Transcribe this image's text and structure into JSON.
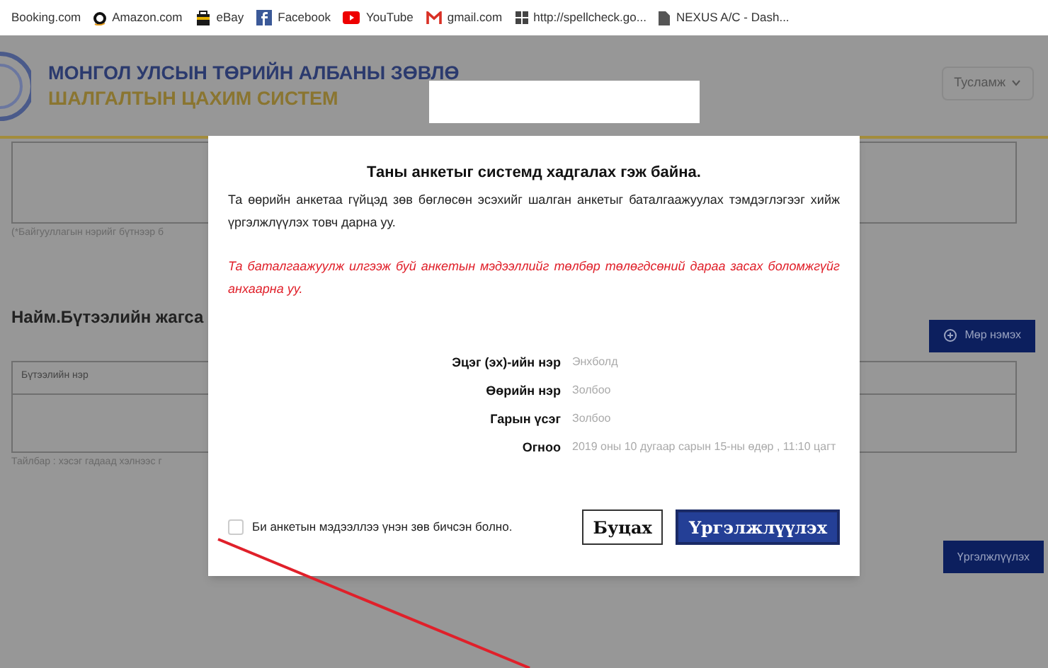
{
  "bookmarks": [
    {
      "label": "Booking.com"
    },
    {
      "label": "Amazon.com"
    },
    {
      "label": "eBay"
    },
    {
      "label": "Facebook"
    },
    {
      "label": "YouTube"
    },
    {
      "label": "gmail.com"
    },
    {
      "label": "http://spellcheck.go..."
    },
    {
      "label": "NEXUS A/C - Dash..."
    }
  ],
  "header": {
    "title": "МОНГОЛ УЛСЫН ТӨРИЙН АЛБАНЫ ЗӨВЛӨ",
    "subtitle": "ШАЛГАЛТЫН ЦАХИМ СИСТЕМ",
    "help_button": "Тусламж"
  },
  "page": {
    "hint_1": "(*Байгууллагын нэрийг бүтнээр б",
    "section_title": "Найм.Бүтээлийн жагса",
    "add_row_button": "Мөр нэмэх",
    "table_column": "Бүтээлийн нэр",
    "hint_2": "Тайлбар : хэсэг гадаад хэлнээс г",
    "continue_button": "Үргэлжлүүлэх"
  },
  "modal": {
    "title": "Таны анкетыг системд хадгалах гэж байна.",
    "message": "Та өөрийн анкетаа гүйцэд зөв бөглөсөн эсэхийг шалган анкетыг баталгаажуулах тэмдэглэгээг хийж үргэлжлүүлэх товч дарна уу.",
    "warning": "Та баталгаажуулж илгээж буй анкетын мэдээллийг төлбөр төлөгдсөний дараа засах боломжгүйг анхаарна уу.",
    "fields": [
      {
        "label": "Эцэг (эх)-ийн нэр",
        "value": "Энхболд"
      },
      {
        "label": "Өөрийн нэр",
        "value": "Золбоо"
      },
      {
        "label": "Гарын үсэг",
        "value": "Золбоо"
      },
      {
        "label": "Огноо",
        "value": "2019 оны 10 дугаар сарын 15-ны өдөр , 11:10 цагт"
      }
    ],
    "agree": {
      "label": "Би анкетын мэдээллээ үнэн зөв бичсэн болно.",
      "checked": false
    },
    "buttons": [
      {
        "label": "Буцах",
        "kind": "secondary"
      },
      {
        "label": "Үргэлжлүүлэх",
        "kind": "primary"
      }
    ]
  }
}
